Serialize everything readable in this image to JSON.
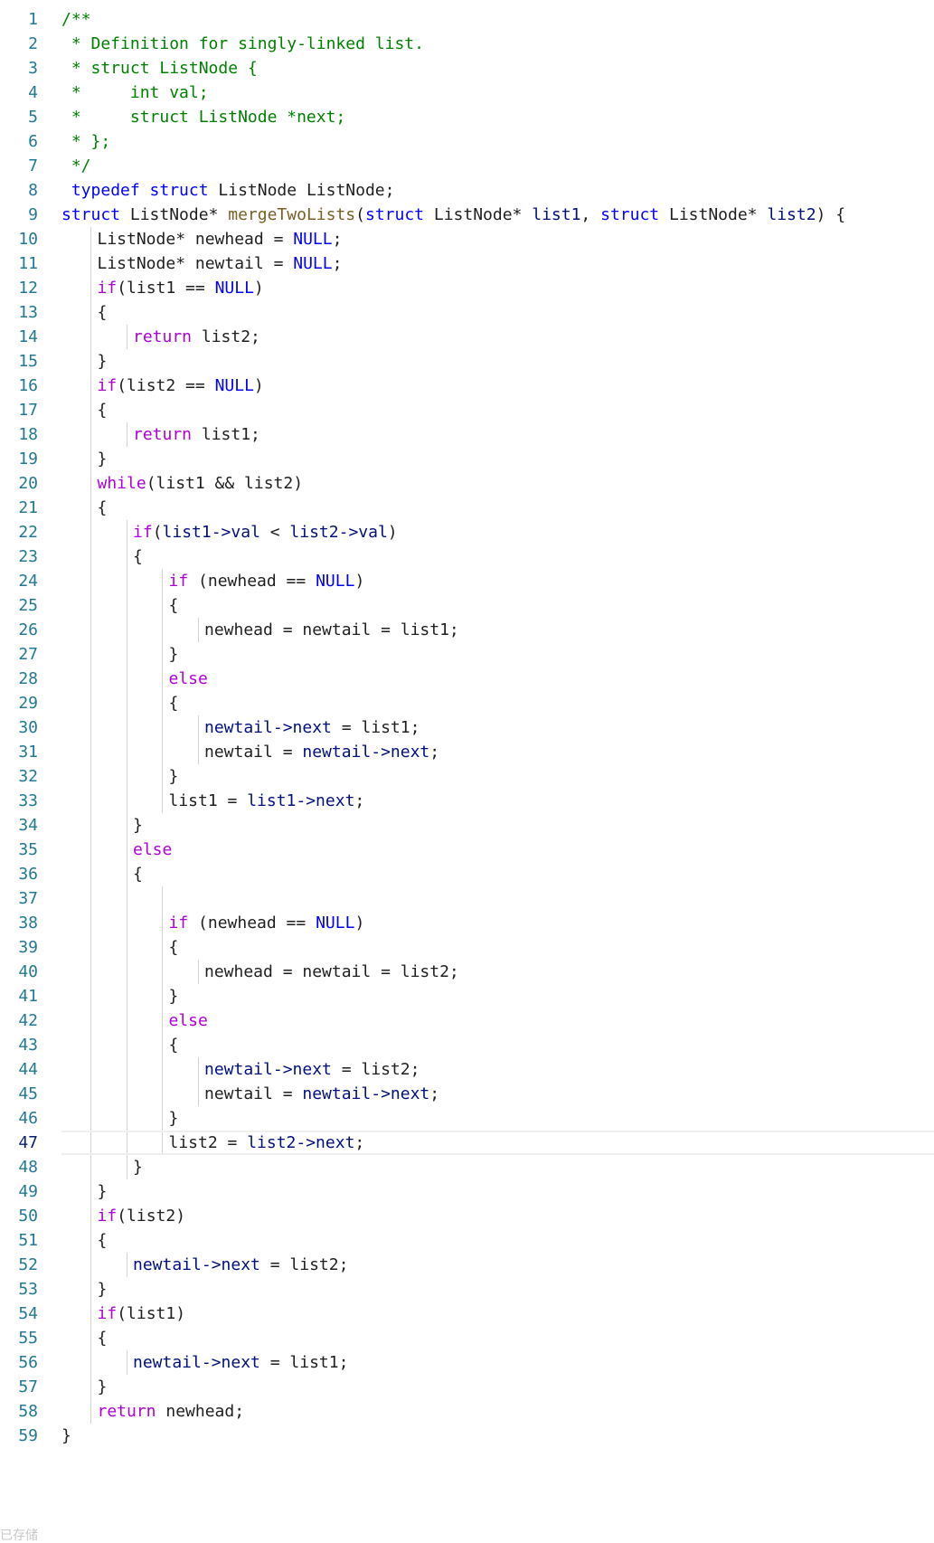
{
  "editor": {
    "current_line": 47,
    "colors": {
      "line_number": "#237893",
      "keyword": "#0000ff",
      "control": "#af00db",
      "function": "#795e26",
      "variable": "#001080",
      "comment": "#008000"
    },
    "lines": [
      {
        "n": "1",
        "i": 0,
        "t": [
          [
            "cm",
            "/**"
          ]
        ]
      },
      {
        "n": "2",
        "i": 0,
        "t": [
          [
            "cm",
            " * Definition for singly-linked list."
          ]
        ]
      },
      {
        "n": "3",
        "i": 0,
        "t": [
          [
            "cm",
            " * struct ListNode {"
          ]
        ]
      },
      {
        "n": "4",
        "i": 0,
        "t": [
          [
            "cm",
            " *     int val;"
          ]
        ]
      },
      {
        "n": "5",
        "i": 0,
        "t": [
          [
            "cm",
            " *     struct ListNode *next;"
          ]
        ]
      },
      {
        "n": "6",
        "i": 0,
        "t": [
          [
            "cm",
            " * };"
          ]
        ]
      },
      {
        "n": "7",
        "i": 0,
        "t": [
          [
            "cm",
            " */"
          ]
        ]
      },
      {
        "n": "8",
        "i": 0,
        "t": [
          [
            "tx",
            " "
          ],
          [
            "kw",
            "typedef"
          ],
          [
            "tx",
            " "
          ],
          [
            "kw",
            "struct"
          ],
          [
            "tx",
            " ListNode ListNode;"
          ]
        ]
      },
      {
        "n": "9",
        "i": 0,
        "t": [
          [
            "kw",
            "struct"
          ],
          [
            "tx",
            " ListNode* "
          ],
          [
            "fn",
            "mergeTwoLists"
          ],
          [
            "tx",
            "("
          ],
          [
            "kw",
            "struct"
          ],
          [
            "tx",
            " ListNode* "
          ],
          [
            "var",
            "list1"
          ],
          [
            "tx",
            ", "
          ],
          [
            "kw",
            "struct"
          ],
          [
            "tx",
            " ListNode* "
          ],
          [
            "var",
            "list2"
          ],
          [
            "tx",
            ") {"
          ]
        ]
      },
      {
        "n": "10",
        "i": 1,
        "t": [
          [
            "tx",
            "ListNode* newhead = "
          ],
          [
            "nul",
            "NULL"
          ],
          [
            "tx",
            ";"
          ]
        ]
      },
      {
        "n": "11",
        "i": 1,
        "t": [
          [
            "tx",
            "ListNode* newtail = "
          ],
          [
            "nul",
            "NULL"
          ],
          [
            "tx",
            ";"
          ]
        ]
      },
      {
        "n": "12",
        "i": 1,
        "t": [
          [
            "ctl",
            "if"
          ],
          [
            "tx",
            "(list1 == "
          ],
          [
            "nul",
            "NULL"
          ],
          [
            "tx",
            ")"
          ]
        ]
      },
      {
        "n": "13",
        "i": 1,
        "t": [
          [
            "tx",
            "{"
          ]
        ]
      },
      {
        "n": "14",
        "i": 2,
        "t": [
          [
            "ctl",
            "return"
          ],
          [
            "tx",
            " list2;"
          ]
        ]
      },
      {
        "n": "15",
        "i": 1,
        "t": [
          [
            "tx",
            "}"
          ]
        ]
      },
      {
        "n": "16",
        "i": 1,
        "t": [
          [
            "ctl",
            "if"
          ],
          [
            "tx",
            "(list2 == "
          ],
          [
            "nul",
            "NULL"
          ],
          [
            "tx",
            ")"
          ]
        ]
      },
      {
        "n": "17",
        "i": 1,
        "t": [
          [
            "tx",
            "{"
          ]
        ]
      },
      {
        "n": "18",
        "i": 2,
        "t": [
          [
            "ctl",
            "return"
          ],
          [
            "tx",
            " list1;"
          ]
        ]
      },
      {
        "n": "19",
        "i": 1,
        "t": [
          [
            "tx",
            "}"
          ]
        ]
      },
      {
        "n": "20",
        "i": 1,
        "t": [
          [
            "ctl",
            "while"
          ],
          [
            "tx",
            "(list1 && list2)"
          ]
        ]
      },
      {
        "n": "21",
        "i": 1,
        "t": [
          [
            "tx",
            "{"
          ]
        ]
      },
      {
        "n": "22",
        "i": 2,
        "t": [
          [
            "ctl",
            "if"
          ],
          [
            "tx",
            "("
          ],
          [
            "var",
            "list1->val"
          ],
          [
            "tx",
            " < "
          ],
          [
            "var",
            "list2->val"
          ],
          [
            "tx",
            ")"
          ]
        ]
      },
      {
        "n": "23",
        "i": 2,
        "t": [
          [
            "tx",
            "{"
          ]
        ]
      },
      {
        "n": "24",
        "i": 3,
        "t": [
          [
            "ctl",
            "if"
          ],
          [
            "tx",
            " (newhead == "
          ],
          [
            "nul",
            "NULL"
          ],
          [
            "tx",
            ")"
          ]
        ]
      },
      {
        "n": "25",
        "i": 3,
        "t": [
          [
            "tx",
            "{"
          ]
        ]
      },
      {
        "n": "26",
        "i": 4,
        "t": [
          [
            "tx",
            "newhead = newtail = list1;"
          ]
        ]
      },
      {
        "n": "27",
        "i": 3,
        "t": [
          [
            "tx",
            "}"
          ]
        ]
      },
      {
        "n": "28",
        "i": 3,
        "t": [
          [
            "ctl",
            "else"
          ]
        ]
      },
      {
        "n": "29",
        "i": 3,
        "t": [
          [
            "tx",
            "{"
          ]
        ]
      },
      {
        "n": "30",
        "i": 4,
        "t": [
          [
            "var",
            "newtail->next"
          ],
          [
            "tx",
            " = list1;"
          ]
        ]
      },
      {
        "n": "31",
        "i": 4,
        "t": [
          [
            "tx",
            "newtail = "
          ],
          [
            "var",
            "newtail->next"
          ],
          [
            "tx",
            ";"
          ]
        ]
      },
      {
        "n": "32",
        "i": 3,
        "t": [
          [
            "tx",
            "}"
          ]
        ]
      },
      {
        "n": "33",
        "i": 3,
        "t": [
          [
            "tx",
            "list1 = "
          ],
          [
            "var",
            "list1->next"
          ],
          [
            "tx",
            ";"
          ]
        ]
      },
      {
        "n": "34",
        "i": 2,
        "t": [
          [
            "tx",
            "}"
          ]
        ]
      },
      {
        "n": "35",
        "i": 2,
        "t": [
          [
            "ctl",
            "else"
          ]
        ]
      },
      {
        "n": "36",
        "i": 2,
        "t": [
          [
            "tx",
            "{"
          ]
        ]
      },
      {
        "n": "37",
        "i": 3,
        "t": []
      },
      {
        "n": "38",
        "i": 3,
        "t": [
          [
            "ctl",
            "if"
          ],
          [
            "tx",
            " (newhead == "
          ],
          [
            "nul",
            "NULL"
          ],
          [
            "tx",
            ")"
          ]
        ]
      },
      {
        "n": "39",
        "i": 3,
        "t": [
          [
            "tx",
            "{"
          ]
        ]
      },
      {
        "n": "40",
        "i": 4,
        "t": [
          [
            "tx",
            "newhead = newtail = list2;"
          ]
        ]
      },
      {
        "n": "41",
        "i": 3,
        "t": [
          [
            "tx",
            "}"
          ]
        ]
      },
      {
        "n": "42",
        "i": 3,
        "t": [
          [
            "ctl",
            "else"
          ]
        ]
      },
      {
        "n": "43",
        "i": 3,
        "t": [
          [
            "tx",
            "{"
          ]
        ]
      },
      {
        "n": "44",
        "i": 4,
        "t": [
          [
            "var",
            "newtail->next"
          ],
          [
            "tx",
            " = list2;"
          ]
        ]
      },
      {
        "n": "45",
        "i": 4,
        "t": [
          [
            "tx",
            "newtail = "
          ],
          [
            "var",
            "newtail->next"
          ],
          [
            "tx",
            ";"
          ]
        ]
      },
      {
        "n": "46",
        "i": 3,
        "t": [
          [
            "tx",
            "}"
          ]
        ]
      },
      {
        "n": "47",
        "i": 3,
        "t": [
          [
            "tx",
            "list2 = "
          ],
          [
            "var",
            "list2->next"
          ],
          [
            "tx",
            ";"
          ]
        ]
      },
      {
        "n": "48",
        "i": 2,
        "t": [
          [
            "tx",
            "}"
          ]
        ]
      },
      {
        "n": "49",
        "i": 1,
        "t": [
          [
            "tx",
            "}"
          ]
        ]
      },
      {
        "n": "50",
        "i": 1,
        "t": [
          [
            "ctl",
            "if"
          ],
          [
            "tx",
            "(list2)"
          ]
        ]
      },
      {
        "n": "51",
        "i": 1,
        "t": [
          [
            "tx",
            "{"
          ]
        ]
      },
      {
        "n": "52",
        "i": 2,
        "t": [
          [
            "var",
            "newtail->next"
          ],
          [
            "tx",
            " = list2;"
          ]
        ]
      },
      {
        "n": "53",
        "i": 1,
        "t": [
          [
            "tx",
            "}"
          ]
        ]
      },
      {
        "n": "54",
        "i": 1,
        "t": [
          [
            "ctl",
            "if"
          ],
          [
            "tx",
            "(list1)"
          ]
        ]
      },
      {
        "n": "55",
        "i": 1,
        "t": [
          [
            "tx",
            "{"
          ]
        ]
      },
      {
        "n": "56",
        "i": 2,
        "t": [
          [
            "var",
            "newtail->next"
          ],
          [
            "tx",
            " = list1;"
          ]
        ]
      },
      {
        "n": "57",
        "i": 1,
        "t": [
          [
            "tx",
            "}"
          ]
        ]
      },
      {
        "n": "58",
        "i": 1,
        "t": [
          [
            "ctl",
            "return"
          ],
          [
            "tx",
            " newhead;"
          ]
        ]
      },
      {
        "n": "59",
        "i": 0,
        "t": [
          [
            "tx",
            "}"
          ]
        ]
      }
    ]
  },
  "footer": {
    "status_text": "已存储"
  }
}
